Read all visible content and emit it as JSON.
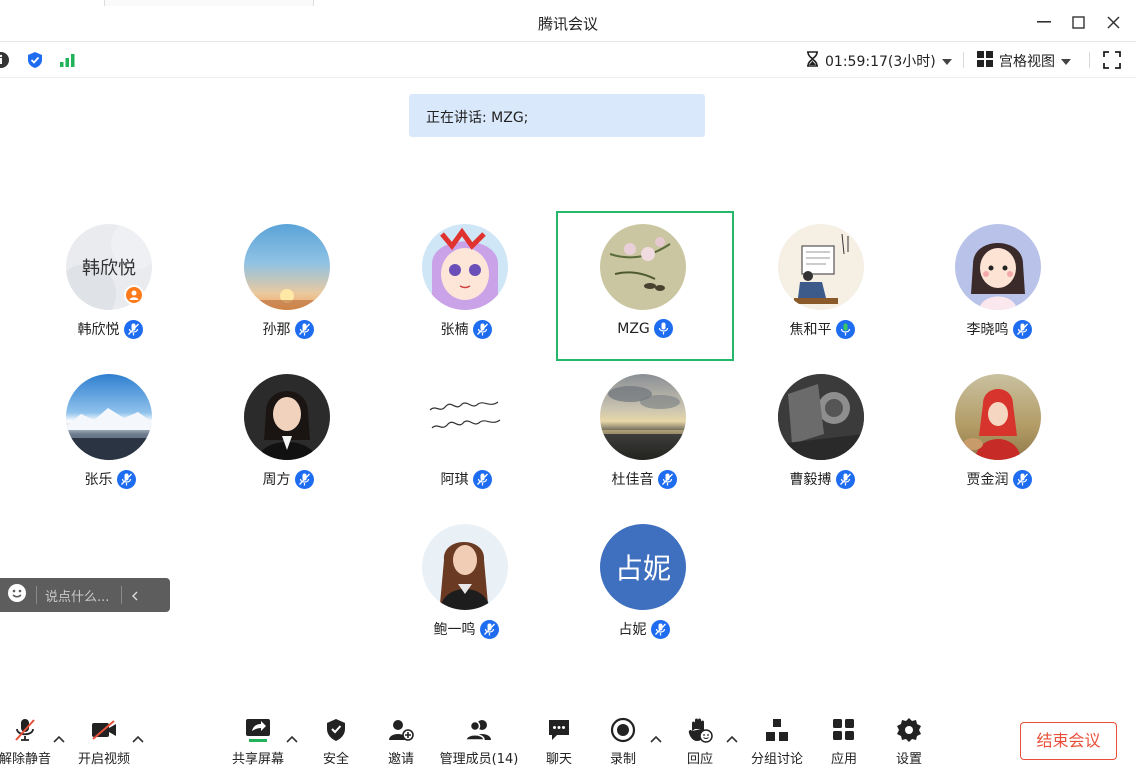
{
  "window": {
    "title": "腾讯会议"
  },
  "topbar": {
    "timer": "01:59:17(3小时)",
    "view_mode": "宫格视图"
  },
  "speaking": {
    "text": "正在讲话: MZG;"
  },
  "participants": [
    {
      "name": "韩欣悦",
      "avatar_text": "韩欣悦"
    },
    {
      "name": "孙那"
    },
    {
      "name": "张楠"
    },
    {
      "name": "MZG",
      "active": true
    },
    {
      "name": "焦和平"
    },
    {
      "name": "李晓鸣"
    },
    {
      "name": "张乐"
    },
    {
      "name": "周方"
    },
    {
      "name": "阿琪"
    },
    {
      "name": "杜佳音"
    },
    {
      "name": "曹毅搏"
    },
    {
      "name": "贾金润"
    },
    {
      "name": "鲍一鸣"
    },
    {
      "name": "占妮",
      "avatar_text": "占妮"
    }
  ],
  "chat": {
    "placeholder": "说点什么..."
  },
  "toolbar": {
    "mute": "解除静音",
    "video": "开启视频",
    "share": "共享屏幕",
    "security": "安全",
    "invite": "邀请",
    "members": "管理成员(14)",
    "chat": "聊天",
    "record": "录制",
    "reaction": "回应",
    "breakout": "分组讨论",
    "apps": "应用",
    "settings": "设置",
    "end": "结束会议"
  },
  "colors": {
    "accent": "#1e6cf0",
    "active_border": "#26b86a",
    "end_red": "#e8503a",
    "speaking_bg": "#d9e8fb"
  }
}
